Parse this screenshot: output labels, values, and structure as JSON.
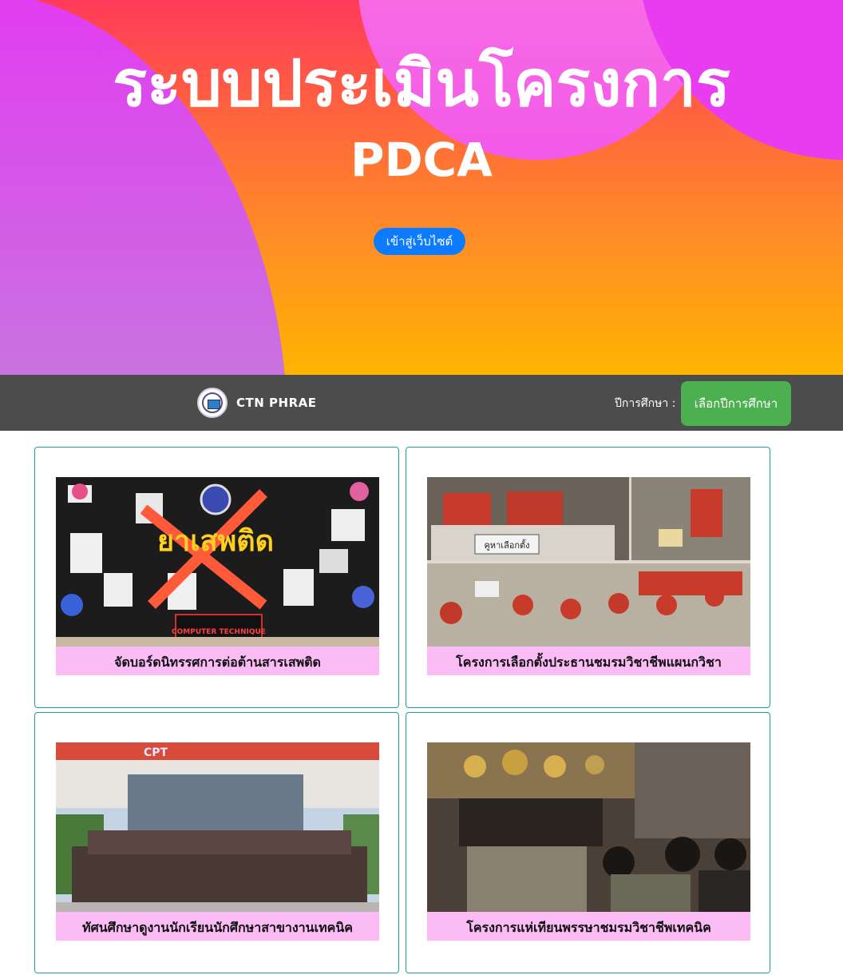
{
  "hero": {
    "title": "ระบบประเมินโครงการ",
    "subtitle": "PDCA",
    "enter_label": "เข้าสู่เว็บไซต์"
  },
  "navbar": {
    "brand": "CTN PHRAE",
    "year_label": "ปีการศึกษา :",
    "year_button": "เลือกปีการศึกษา"
  },
  "projects": [
    {
      "title": "จัดบอร์ดนิทรรศการต่อต้านสารเสพติด",
      "image_text": "ยาเสพติด",
      "image_subtext": "COMPUTER TECHNIQUE"
    },
    {
      "title": "โครงการเลือกตั้งประธานชมรมวิชาชีพแผนกวิชา",
      "image_text": "คูหาเลือกตั้ง"
    },
    {
      "title": "ทัศนศึกษาดูงานนักเรียนนักศึกษาสาขางานเทคนิค",
      "image_text": "CPT"
    },
    {
      "title": "โครงการแห่เทียนพรรษาชมรมวิชาชีพเทคนิค"
    }
  ],
  "colors": {
    "hero_top": "#ff3a5a",
    "hero_bottom": "#ffb400",
    "blob_purple": "#e23cf0",
    "enter_button": "#0d7bff",
    "navbar": "#4c4c4c",
    "year_button": "#4caf50",
    "card_border": "#1aa3a3",
    "caption_bg": "#fbbcf6"
  }
}
